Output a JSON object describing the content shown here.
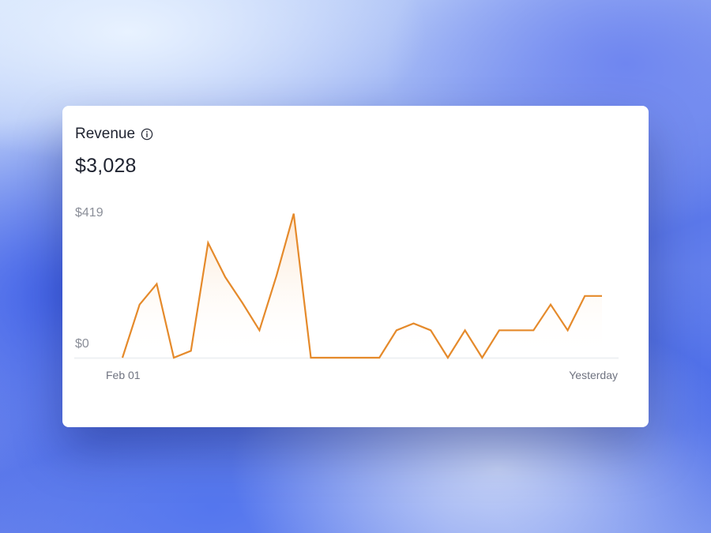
{
  "card": {
    "title": "Revenue",
    "info_icon": "info-circle-icon",
    "total": "$3,028"
  },
  "colors": {
    "line": "#e58a2b",
    "fill_top": "#fde6cf",
    "baseline": "#eef0f3"
  },
  "chart_data": {
    "type": "area",
    "title": "Revenue",
    "y_tick_labels": [
      "$0",
      "$419"
    ],
    "ylim": [
      0,
      419
    ],
    "x_tick_labels": [
      "Feb 01",
      "Yesterday"
    ],
    "grid": false,
    "legend": "none",
    "values": [
      0,
      155,
      215,
      0,
      20,
      335,
      235,
      160,
      80,
      240,
      420,
      0,
      0,
      0,
      0,
      0,
      80,
      100,
      80,
      0,
      80,
      0,
      80,
      80,
      80,
      155,
      80,
      180,
      180
    ]
  }
}
